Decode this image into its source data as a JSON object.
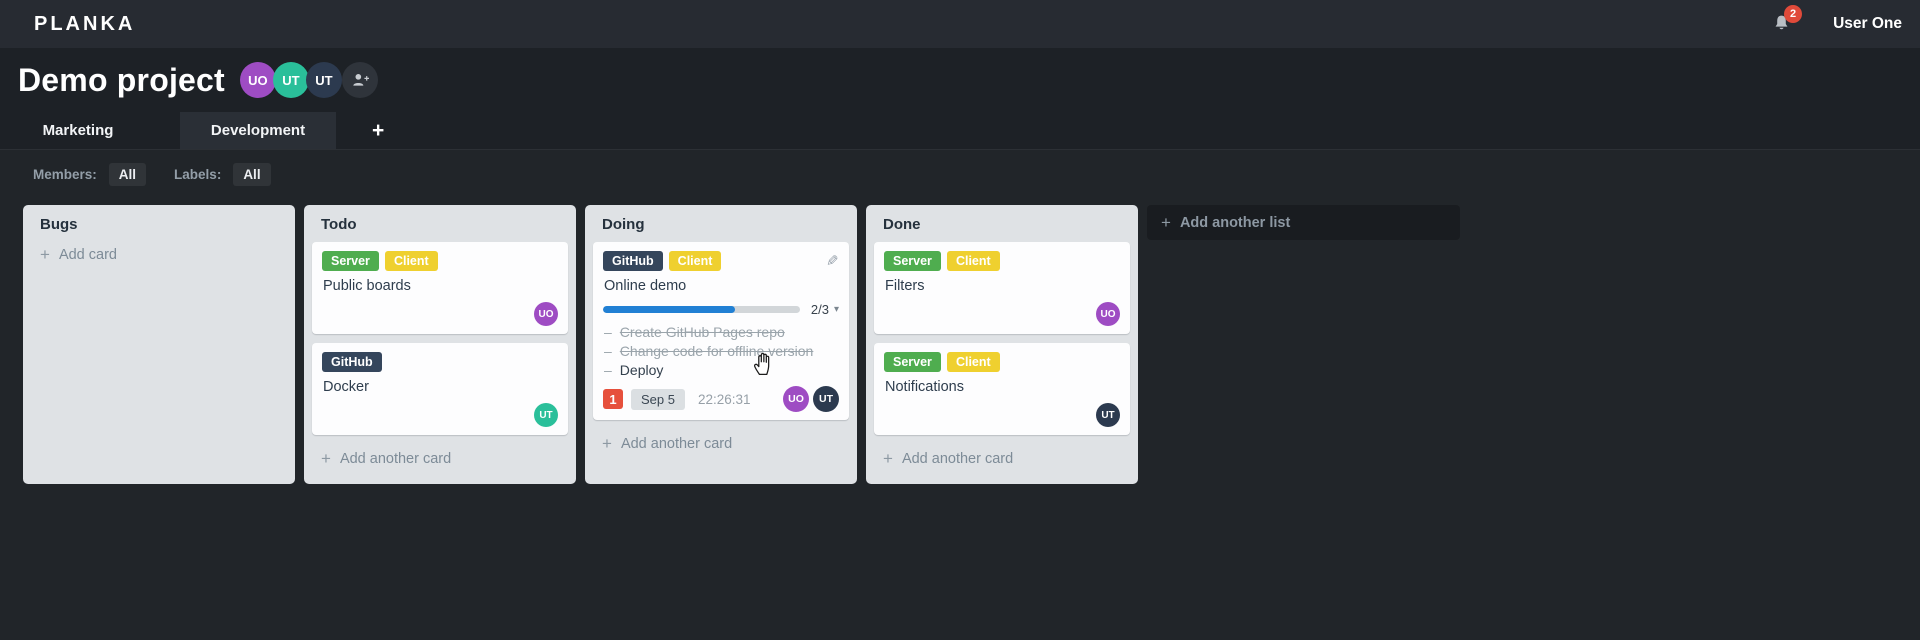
{
  "topbar": {
    "logo": "PLANKA",
    "notifications": {
      "count": "2"
    },
    "user_name": "User One"
  },
  "project": {
    "title": "Demo project",
    "members": [
      {
        "initials": "UO",
        "color": "#9e4cc3"
      },
      {
        "initials": "UT",
        "color": "#2abf9a"
      },
      {
        "initials": "UT",
        "color": "#2c3a4f"
      }
    ]
  },
  "tabs": {
    "items": [
      {
        "label": "Marketing",
        "active": false
      },
      {
        "label": "Development",
        "active": true
      }
    ],
    "add_label": "+"
  },
  "filters": {
    "members_label": "Members:",
    "members_value": "All",
    "labels_label": "Labels:",
    "labels_value": "All"
  },
  "board": {
    "add_list_label": "Add another list",
    "lists": [
      {
        "title": "Bugs",
        "footer": "Add card",
        "cards": []
      },
      {
        "title": "Todo",
        "footer": "Add another card",
        "cards": [
          {
            "title": "Public boards",
            "labels": [
              {
                "text": "Server",
                "color": "#4fad4f"
              },
              {
                "text": "Client",
                "color": "#efd02f"
              }
            ],
            "members": [
              {
                "initials": "UO",
                "color": "#9e4cc3"
              }
            ]
          },
          {
            "title": "Docker",
            "labels": [
              {
                "text": "GitHub",
                "color": "#35465c"
              }
            ],
            "members": [
              {
                "initials": "UT",
                "color": "#2abf9a"
              }
            ]
          }
        ]
      },
      {
        "title": "Doing",
        "footer": "Add another card",
        "cards": [
          {
            "title": "Online demo",
            "edit_icon": true,
            "labels": [
              {
                "text": "GitHub",
                "color": "#35465c"
              },
              {
                "text": "Client",
                "color": "#efd02f"
              }
            ],
            "progress": {
              "done": 2,
              "total": 3,
              "text": "2/3",
              "percent": 67,
              "bar_color": "#2180d4"
            },
            "tasks": [
              {
                "text": "Create GitHub Pages repo",
                "done": true
              },
              {
                "text": "Change code for offline version",
                "done": true
              },
              {
                "text": "Deploy",
                "done": false
              }
            ],
            "notification_count": "1",
            "due_date": "Sep 5",
            "timer": "22:26:31",
            "members": [
              {
                "initials": "UO",
                "color": "#9e4cc3"
              },
              {
                "initials": "UT",
                "color": "#2c3a4f"
              }
            ]
          }
        ]
      },
      {
        "title": "Done",
        "footer": "Add another card",
        "cards": [
          {
            "title": "Filters",
            "labels": [
              {
                "text": "Server",
                "color": "#4fad4f"
              },
              {
                "text": "Client",
                "color": "#efd02f"
              }
            ],
            "members": [
              {
                "initials": "UO",
                "color": "#9e4cc3"
              }
            ]
          },
          {
            "title": "Notifications",
            "labels": [
              {
                "text": "Server",
                "color": "#4fad4f"
              },
              {
                "text": "Client",
                "color": "#efd02f"
              }
            ],
            "members": [
              {
                "initials": "UT",
                "color": "#2c3a4f"
              }
            ]
          }
        ]
      }
    ]
  }
}
